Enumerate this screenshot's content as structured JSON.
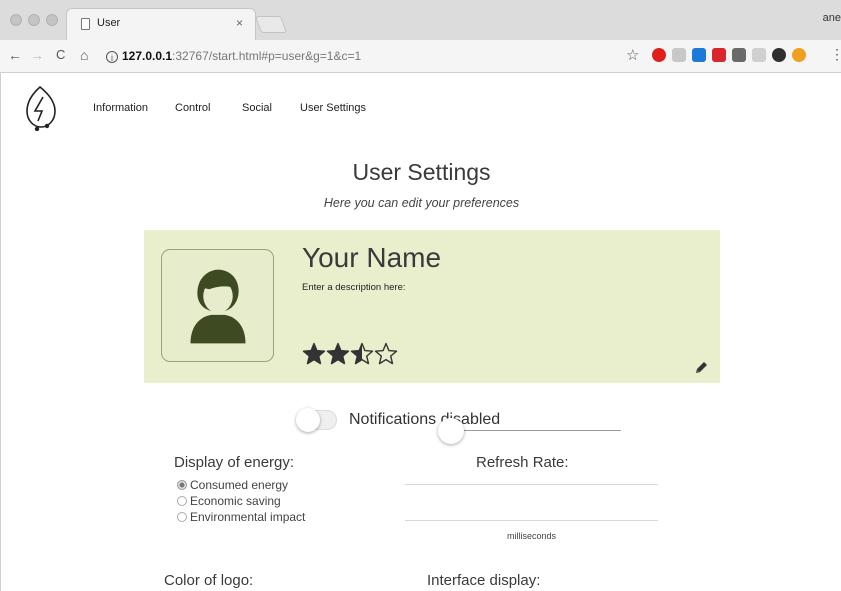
{
  "browser": {
    "tab_title": "User",
    "tab_close": "×",
    "profile_name": "ane",
    "url_host": "127.0.0.1",
    "url_rest": ":32767/start.html#p=user&g=1&c=1",
    "info_glyph": "i",
    "nav_back": "←",
    "nav_forward": "→",
    "nav_reload": "C",
    "nav_home": "⌂",
    "bookmark_star": "☆",
    "menu_dots": "⋮"
  },
  "nav": {
    "items": [
      "Information",
      "Control",
      "Social",
      "User Settings"
    ]
  },
  "page": {
    "title": "User Settings",
    "subtitle": "Here you can edit your preferences"
  },
  "profile": {
    "name": "Your Name",
    "description": "Enter a description here:",
    "rating": 2.5,
    "rating_max": 4
  },
  "notifications": {
    "label": "Notifications disabled",
    "enabled": false
  },
  "energy": {
    "label": "Display of energy:",
    "options": [
      "Consumed energy",
      "Economic saving",
      "Environmental impact"
    ],
    "selected": 0
  },
  "refresh": {
    "label": "Refresh Rate:",
    "unit": "milliseconds",
    "value_fraction": 0.0
  },
  "logo_color": {
    "label": "Color of logo:"
  },
  "interface": {
    "label": "Interface display:"
  },
  "colors": {
    "card_bg": "#e9efcd",
    "avatar_fg": "#3e4a22",
    "star": "#333333"
  }
}
